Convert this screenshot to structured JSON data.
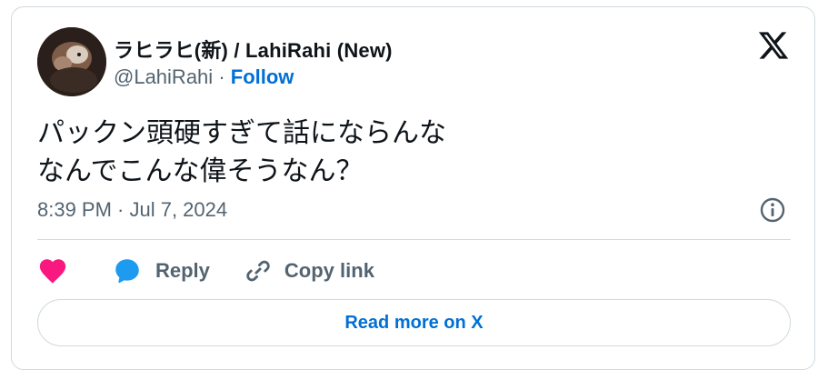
{
  "author": {
    "display_name": "ラヒラヒ(新) / LahiRahi (New)",
    "handle": "@LahiRahi",
    "separator": "·",
    "follow_label": "Follow"
  },
  "tweet": {
    "line1": "パックン頭硬すぎて話にならんな",
    "line2": "なんでこんな偉そうなん？",
    "timestamp": "8:39 PM · Jul 7, 2024"
  },
  "actions": {
    "reply_label": "Reply",
    "copy_link_label": "Copy link"
  },
  "read_more_label": "Read more on X",
  "icons": {
    "logo": "x-logo-icon",
    "info": "info-icon",
    "like": "heart-icon",
    "reply": "speech-bubble-icon",
    "copy": "link-icon"
  },
  "colors": {
    "link_blue": "#006fd6",
    "like_pink": "#f91880",
    "reply_blue": "#1d9bf0",
    "muted_text": "#536471",
    "border": "#cfd9de"
  }
}
